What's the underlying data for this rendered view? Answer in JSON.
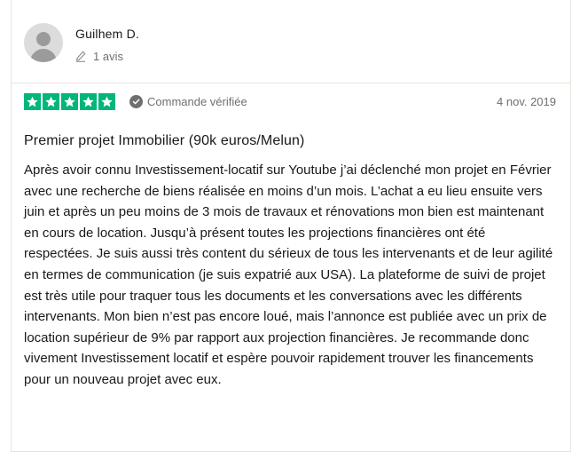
{
  "review": {
    "consumer": {
      "name": "Guilhem D.",
      "reviews_count": "1 avis",
      "avatar_icon": "user-silhouette-icon"
    },
    "rating": {
      "stars": 5,
      "max": 5,
      "color": "#00b67a"
    },
    "verified_label": "Commande vérifiée",
    "date": "4 nov. 2019",
    "title": "Premier projet Immobilier (90k euros/Melun)",
    "text": "Après avoir connu Investissement-locatif sur Youtube j’ai déclenché mon projet en Février avec une recherche de biens réalisée en moins d’un mois. L’achat a eu lieu ensuite vers juin et après un peu moins de 3 mois de travaux et rénovations mon bien est maintenant en cours de location. Jusqu’à présent toutes les projections financières ont été respectées. Je suis aussi très content du sérieux de tous les intervenants et de leur agilité en termes de communication (je suis expatrié aux USA). La plateforme de suivi de projet est très utile pour traquer tous les documents et les conversations avec les différents intervenants. Mon bien n’est pas encore loué, mais l’annonce est publiée avec un prix de location supérieur de 9% par rapport aux projection financières. Je recommande donc vivement Investissement locatif et espère pouvoir rapidement trouver les financements pour un nouveau projet avec eux."
  }
}
